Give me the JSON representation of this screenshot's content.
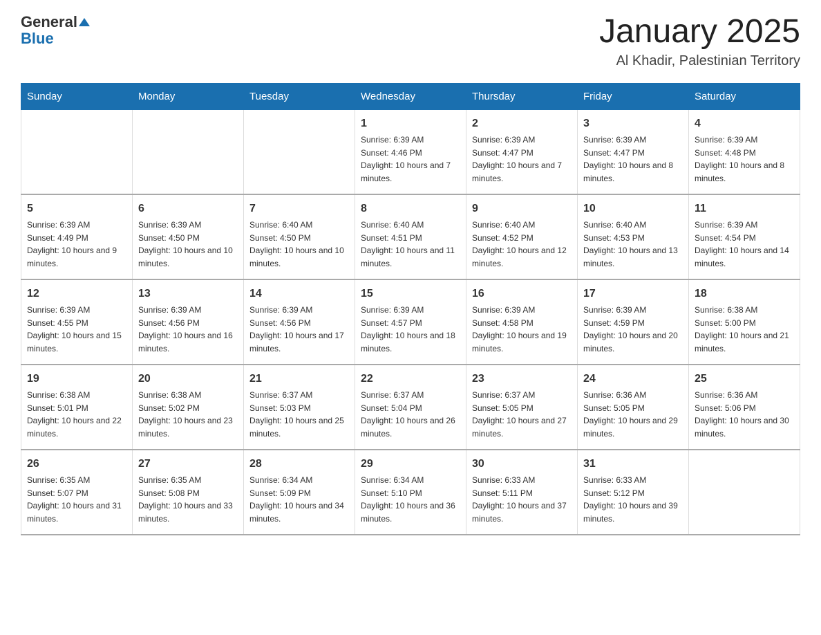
{
  "header": {
    "logo_general": "General",
    "logo_blue": "Blue",
    "month_title": "January 2025",
    "location": "Al Khadir, Palestinian Territory"
  },
  "days_of_week": [
    "Sunday",
    "Monday",
    "Tuesday",
    "Wednesday",
    "Thursday",
    "Friday",
    "Saturday"
  ],
  "weeks": [
    [
      {
        "day": "",
        "info": ""
      },
      {
        "day": "",
        "info": ""
      },
      {
        "day": "",
        "info": ""
      },
      {
        "day": "1",
        "info": "Sunrise: 6:39 AM\nSunset: 4:46 PM\nDaylight: 10 hours and 7 minutes."
      },
      {
        "day": "2",
        "info": "Sunrise: 6:39 AM\nSunset: 4:47 PM\nDaylight: 10 hours and 7 minutes."
      },
      {
        "day": "3",
        "info": "Sunrise: 6:39 AM\nSunset: 4:47 PM\nDaylight: 10 hours and 8 minutes."
      },
      {
        "day": "4",
        "info": "Sunrise: 6:39 AM\nSunset: 4:48 PM\nDaylight: 10 hours and 8 minutes."
      }
    ],
    [
      {
        "day": "5",
        "info": "Sunrise: 6:39 AM\nSunset: 4:49 PM\nDaylight: 10 hours and 9 minutes."
      },
      {
        "day": "6",
        "info": "Sunrise: 6:39 AM\nSunset: 4:50 PM\nDaylight: 10 hours and 10 minutes."
      },
      {
        "day": "7",
        "info": "Sunrise: 6:40 AM\nSunset: 4:50 PM\nDaylight: 10 hours and 10 minutes."
      },
      {
        "day": "8",
        "info": "Sunrise: 6:40 AM\nSunset: 4:51 PM\nDaylight: 10 hours and 11 minutes."
      },
      {
        "day": "9",
        "info": "Sunrise: 6:40 AM\nSunset: 4:52 PM\nDaylight: 10 hours and 12 minutes."
      },
      {
        "day": "10",
        "info": "Sunrise: 6:40 AM\nSunset: 4:53 PM\nDaylight: 10 hours and 13 minutes."
      },
      {
        "day": "11",
        "info": "Sunrise: 6:39 AM\nSunset: 4:54 PM\nDaylight: 10 hours and 14 minutes."
      }
    ],
    [
      {
        "day": "12",
        "info": "Sunrise: 6:39 AM\nSunset: 4:55 PM\nDaylight: 10 hours and 15 minutes."
      },
      {
        "day": "13",
        "info": "Sunrise: 6:39 AM\nSunset: 4:56 PM\nDaylight: 10 hours and 16 minutes."
      },
      {
        "day": "14",
        "info": "Sunrise: 6:39 AM\nSunset: 4:56 PM\nDaylight: 10 hours and 17 minutes."
      },
      {
        "day": "15",
        "info": "Sunrise: 6:39 AM\nSunset: 4:57 PM\nDaylight: 10 hours and 18 minutes."
      },
      {
        "day": "16",
        "info": "Sunrise: 6:39 AM\nSunset: 4:58 PM\nDaylight: 10 hours and 19 minutes."
      },
      {
        "day": "17",
        "info": "Sunrise: 6:39 AM\nSunset: 4:59 PM\nDaylight: 10 hours and 20 minutes."
      },
      {
        "day": "18",
        "info": "Sunrise: 6:38 AM\nSunset: 5:00 PM\nDaylight: 10 hours and 21 minutes."
      }
    ],
    [
      {
        "day": "19",
        "info": "Sunrise: 6:38 AM\nSunset: 5:01 PM\nDaylight: 10 hours and 22 minutes."
      },
      {
        "day": "20",
        "info": "Sunrise: 6:38 AM\nSunset: 5:02 PM\nDaylight: 10 hours and 23 minutes."
      },
      {
        "day": "21",
        "info": "Sunrise: 6:37 AM\nSunset: 5:03 PM\nDaylight: 10 hours and 25 minutes."
      },
      {
        "day": "22",
        "info": "Sunrise: 6:37 AM\nSunset: 5:04 PM\nDaylight: 10 hours and 26 minutes."
      },
      {
        "day": "23",
        "info": "Sunrise: 6:37 AM\nSunset: 5:05 PM\nDaylight: 10 hours and 27 minutes."
      },
      {
        "day": "24",
        "info": "Sunrise: 6:36 AM\nSunset: 5:05 PM\nDaylight: 10 hours and 29 minutes."
      },
      {
        "day": "25",
        "info": "Sunrise: 6:36 AM\nSunset: 5:06 PM\nDaylight: 10 hours and 30 minutes."
      }
    ],
    [
      {
        "day": "26",
        "info": "Sunrise: 6:35 AM\nSunset: 5:07 PM\nDaylight: 10 hours and 31 minutes."
      },
      {
        "day": "27",
        "info": "Sunrise: 6:35 AM\nSunset: 5:08 PM\nDaylight: 10 hours and 33 minutes."
      },
      {
        "day": "28",
        "info": "Sunrise: 6:34 AM\nSunset: 5:09 PM\nDaylight: 10 hours and 34 minutes."
      },
      {
        "day": "29",
        "info": "Sunrise: 6:34 AM\nSunset: 5:10 PM\nDaylight: 10 hours and 36 minutes."
      },
      {
        "day": "30",
        "info": "Sunrise: 6:33 AM\nSunset: 5:11 PM\nDaylight: 10 hours and 37 minutes."
      },
      {
        "day": "31",
        "info": "Sunrise: 6:33 AM\nSunset: 5:12 PM\nDaylight: 10 hours and 39 minutes."
      },
      {
        "day": "",
        "info": ""
      }
    ]
  ]
}
